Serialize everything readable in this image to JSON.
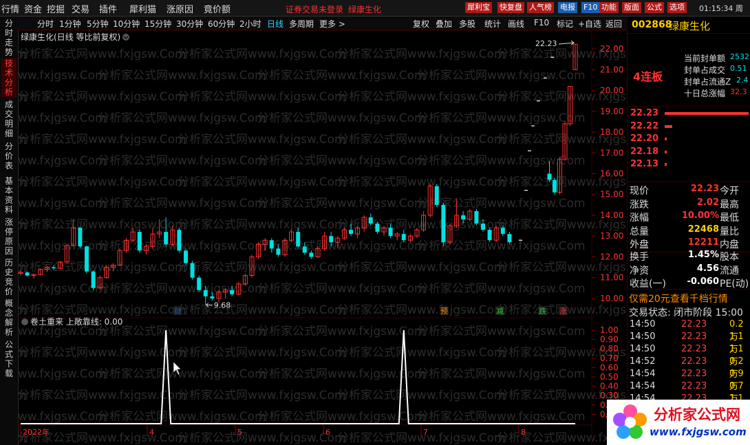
{
  "menu": [
    "行情",
    "资金",
    "挖掘",
    "交易",
    "插件",
    "犀利猫",
    "涨原因",
    "竟价额"
  ],
  "notices": [
    "证券交易未登录",
    "绿康生化"
  ],
  "toolbar_buttons": [
    "犀利宝",
    "快复盘",
    "人气榜",
    "电报",
    "F10",
    "功能",
    "版面",
    "公式",
    "选项"
  ],
  "clock": "01:15:34 周",
  "periods": [
    "分时",
    "1分钟",
    "5分钟",
    "10分钟",
    "15分钟",
    "30分钟",
    "60分钟",
    "2小时",
    "日线",
    "多周期",
    "更多 >"
  ],
  "active_period": "日线",
  "tools": [
    "复权",
    "叠加",
    "多股",
    "统计",
    "画线",
    "F10",
    "标记",
    "+自选",
    "返回"
  ],
  "side_tabs": [
    "分时走势",
    "技术分析",
    "成交明细",
    "分价表",
    "基本资料",
    "涨停原因",
    "历史竞价",
    "概念解析",
    "公式下载"
  ],
  "chart": {
    "title": "绿康生化(日线 等比前复权)",
    "price_ticks": [
      "22.00",
      "21.00",
      "20.00",
      "19.00",
      "18.00",
      "17.00",
      "16.00",
      "15.00",
      "14.00",
      "13.00",
      "12.00",
      "11.00",
      "10.00"
    ],
    "max_label": "22.23",
    "min_label": "9.68",
    "event_markers": [
      "财",
      "预",
      "减",
      "跌",
      "涨"
    ],
    "watermark": "分析家公式网www.fxjgsw.Com",
    "months": [
      "2022年",
      "4",
      "5",
      "6",
      "7",
      "8"
    ],
    "indicator_title": "卷土重来 上敞靠线: 0.00",
    "indicator_ticks": [
      "1.00",
      "0.90",
      "0.80",
      "0.70",
      "0.60",
      "0.50",
      "0.40",
      "0.30",
      "0.20",
      "0.10"
    ]
  },
  "quote": {
    "code": "002868",
    "name": "绿康生化",
    "streak": "4连板",
    "seal_items": [
      "当前封单额",
      "封单占成交",
      "封单占流通Z",
      "十日总涨幅"
    ],
    "seal_values": [
      "2532",
      "0.51",
      "2.4",
      "32.3"
    ],
    "bid_prices": [
      "22.23",
      "22.22",
      "22.20",
      "22.18",
      "22.13"
    ],
    "bid_levels": [
      1.0,
      0.09,
      0.02,
      0.02,
      0.02
    ],
    "stats": [
      {
        "label": "现价",
        "value": "22.23",
        "label2": "今开"
      },
      {
        "label": "涨跌",
        "value": "2.02",
        "label2": "最高"
      },
      {
        "label": "涨幅",
        "value": "10.00%",
        "label2": "最低"
      },
      {
        "label": "总量",
        "value": "22468",
        "label2": "量比"
      },
      {
        "label": "外盘",
        "value": "12211",
        "label2": "内盘"
      }
    ],
    "stats2": [
      {
        "label": "换手",
        "value": "1.45%",
        "label2": "股本"
      },
      {
        "label": "净资",
        "value": "4.56",
        "label2": "流通"
      },
      {
        "label": "收益(一)",
        "value": "-0.060",
        "label2": "PE(动)"
      }
    ],
    "promo": "仅需20元查看千档行情",
    "trade_status": "交易状态: 闭市阶段 15:00",
    "ticks": [
      {
        "time": "14:50",
        "price": "22.23",
        "vol": "0.2万"
      },
      {
        "time": "14:50",
        "price": "22.23",
        "vol": "1.1万"
      },
      {
        "time": "14:50",
        "price": "22.23",
        "vol": "1.1万"
      },
      {
        "time": "14:52",
        "price": "22.23",
        "vol": "0.2万"
      },
      {
        "time": "14:54",
        "price": "22.23",
        "vol": "0.9万"
      },
      {
        "time": "14:54",
        "price": "22.23",
        "vol": "0.7万"
      },
      {
        "time": "14:54",
        "price": "22.23",
        "vol": "1.1万"
      }
    ],
    "logo_text": "分析家公式网",
    "logo_url": "www.fxjgsw.com"
  },
  "colors": {
    "up": "#ff3232",
    "down": "#00e0e0",
    "accent": "#ff4040",
    "yellow": "#ffd000"
  },
  "chart_data": {
    "type": "candlestick",
    "candles": [
      [
        11.2,
        11.35,
        11.1,
        11.25
      ],
      [
        11.25,
        11.3,
        11.05,
        11.1
      ],
      [
        11.1,
        11.2,
        10.95,
        11.15
      ],
      [
        11.15,
        11.45,
        11.1,
        11.4
      ],
      [
        11.4,
        11.55,
        11.3,
        11.5
      ],
      [
        11.5,
        11.6,
        11.35,
        11.45
      ],
      [
        11.45,
        11.8,
        11.4,
        11.75
      ],
      [
        11.75,
        12.6,
        11.7,
        12.55
      ],
      [
        12.55,
        13.8,
        12.5,
        13.4
      ],
      [
        13.4,
        13.45,
        12.4,
        12.5
      ],
      [
        12.5,
        12.55,
        11.2,
        11.3
      ],
      [
        11.3,
        11.35,
        10.4,
        10.5
      ],
      [
        10.5,
        11.1,
        10.45,
        11.0
      ],
      [
        11.0,
        11.6,
        10.95,
        11.5
      ],
      [
        11.5,
        11.7,
        11.3,
        11.6
      ],
      [
        11.6,
        12.4,
        11.55,
        12.3
      ],
      [
        12.3,
        12.9,
        12.2,
        12.8
      ],
      [
        12.8,
        13.4,
        12.7,
        13.2
      ],
      [
        13.2,
        13.3,
        12.2,
        12.3
      ],
      [
        12.3,
        12.6,
        12.1,
        12.5
      ],
      [
        12.5,
        13.4,
        12.4,
        13.1
      ],
      [
        13.1,
        13.8,
        12.9,
        13.2
      ],
      [
        13.2,
        13.9,
        12.5,
        12.6
      ],
      [
        12.6,
        13.5,
        12.5,
        13.3
      ],
      [
        13.3,
        13.4,
        12.2,
        12.3
      ],
      [
        12.3,
        12.4,
        11.6,
        11.7
      ],
      [
        11.7,
        11.8,
        10.9,
        11.0
      ],
      [
        11.0,
        11.1,
        10.3,
        10.4
      ],
      [
        10.4,
        10.6,
        9.68,
        10.1
      ],
      [
        10.1,
        10.3,
        9.9,
        10.0
      ],
      [
        10.0,
        10.4,
        9.8,
        10.3
      ],
      [
        10.3,
        10.5,
        10.0,
        10.4
      ],
      [
        10.4,
        10.6,
        10.1,
        10.2
      ],
      [
        10.2,
        10.8,
        10.15,
        10.7
      ],
      [
        10.7,
        11.2,
        10.6,
        11.1
      ],
      [
        11.1,
        12.1,
        11.0,
        12.0
      ],
      [
        12.0,
        12.7,
        11.9,
        12.6
      ],
      [
        12.6,
        12.9,
        12.3,
        12.8
      ],
      [
        12.8,
        12.9,
        12.2,
        12.4
      ],
      [
        12.4,
        12.6,
        12.0,
        12.1
      ],
      [
        12.1,
        12.9,
        12.0,
        12.8
      ],
      [
        12.8,
        13.3,
        12.7,
        13.2
      ],
      [
        13.2,
        13.4,
        12.4,
        12.5
      ],
      [
        12.5,
        12.7,
        12.1,
        12.2
      ],
      [
        12.2,
        12.3,
        11.9,
        12.0
      ],
      [
        12.0,
        12.5,
        11.95,
        12.4
      ],
      [
        12.4,
        13.2,
        12.3,
        13.0
      ],
      [
        13.0,
        13.2,
        12.5,
        12.7
      ],
      [
        12.7,
        13.0,
        12.4,
        12.9
      ],
      [
        12.9,
        13.4,
        12.8,
        13.3
      ],
      [
        13.3,
        13.6,
        13.0,
        13.1
      ],
      [
        13.1,
        13.5,
        12.9,
        13.4
      ],
      [
        13.4,
        14.0,
        13.2,
        13.9
      ],
      [
        13.9,
        14.1,
        13.5,
        13.6
      ],
      [
        13.6,
        13.7,
        13.1,
        13.2
      ],
      [
        13.2,
        13.5,
        13.0,
        13.4
      ],
      [
        13.4,
        13.6,
        12.9,
        13.0
      ],
      [
        13.0,
        13.2,
        12.8,
        13.1
      ],
      [
        13.1,
        13.3,
        12.7,
        12.8
      ],
      [
        12.8,
        13.1,
        12.7,
        13.0
      ],
      [
        13.0,
        13.4,
        12.9,
        13.3
      ],
      [
        13.3,
        14.2,
        13.2,
        14.0
      ],
      [
        14.0,
        15.5,
        13.9,
        15.4
      ],
      [
        15.4,
        15.5,
        14.4,
        14.5
      ],
      [
        14.5,
        14.6,
        12.5,
        12.7
      ],
      [
        12.7,
        13.6,
        12.6,
        13.5
      ],
      [
        13.5,
        14.8,
        13.4,
        14.0
      ],
      [
        14.0,
        14.2,
        13.6,
        13.8
      ],
      [
        13.8,
        14.3,
        13.7,
        14.2
      ],
      [
        14.2,
        14.3,
        13.5,
        13.6
      ],
      [
        13.6,
        13.8,
        13.2,
        13.3
      ],
      [
        13.3,
        13.4,
        12.7,
        12.8
      ],
      [
        12.8,
        13.5,
        12.7,
        13.4
      ],
      [
        13.4,
        13.5,
        13.0,
        13.1
      ],
      [
        13.1,
        13.2,
        12.6,
        12.7
      ],
      [
        16.0,
        16.6,
        15.6,
        15.7
      ],
      [
        15.7,
        15.8,
        15.0,
        15.1
      ],
      [
        15.1,
        16.8,
        15.0,
        16.7
      ],
      [
        16.7,
        18.5,
        16.6,
        18.4
      ],
      [
        18.4,
        20.2,
        18.3,
        20.2
      ],
      [
        21.0,
        22.23,
        21.0,
        22.23
      ]
    ],
    "ylim": [
      9.5,
      22.5
    ],
    "indicator": {
      "ylim": [
        0,
        1.0
      ],
      "spikes_at": [
        22,
        58
      ]
    },
    "x_months": [
      "2022年",
      "4",
      "5",
      "6",
      "7",
      "8"
    ]
  }
}
